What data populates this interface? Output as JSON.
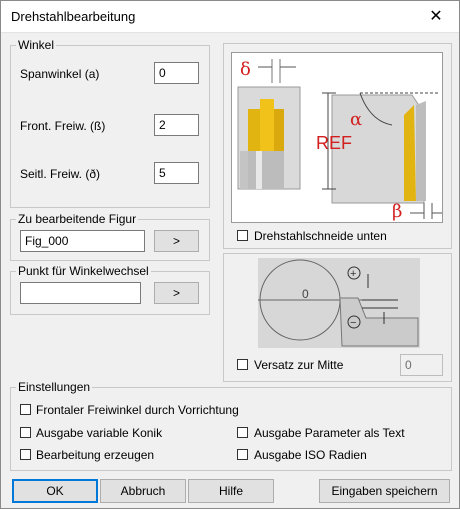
{
  "window": {
    "title": "Drehstahlbearbeitung",
    "close_glyph": "✕"
  },
  "winkel": {
    "label": "Winkel",
    "fields": [
      {
        "label": "Spanwinkel (a)",
        "value": "0"
      },
      {
        "label": "Front. Freiw. (ß)",
        "value": "2"
      },
      {
        "label": "Seitl. Freiw. (ð)",
        "value": "5"
      }
    ]
  },
  "figur": {
    "label": "Zu bearbeitende Figur",
    "value": "Fig_000",
    "button": ">"
  },
  "punkt": {
    "label": "Punkt für Winkelwechsel",
    "value": "",
    "button": ">"
  },
  "diagram1": {
    "delta": "δ",
    "alpha": "α",
    "ref": "REF",
    "beta": "β",
    "checkbox": "Drehstahlschneide unten",
    "colors": {
      "accent": "#d21f1f",
      "tool": "#e2b412"
    }
  },
  "diagram2": {
    "zero": "0",
    "plus": "+",
    "minus": "−",
    "checkbox": "Versatz zur Mitte",
    "value": "0"
  },
  "einstellungen": {
    "label": "Einstellungen",
    "options": [
      "Frontaler Freiwinkel durch Vorrichtung",
      "Ausgabe variable Konik",
      "Ausgabe Parameter als Text",
      "Bearbeitung erzeugen",
      "Ausgabe ISO Radien"
    ]
  },
  "buttons": {
    "ok": "OK",
    "abbruch": "Abbruch",
    "hilfe": "Hilfe",
    "speichern": "Eingaben speichern"
  }
}
